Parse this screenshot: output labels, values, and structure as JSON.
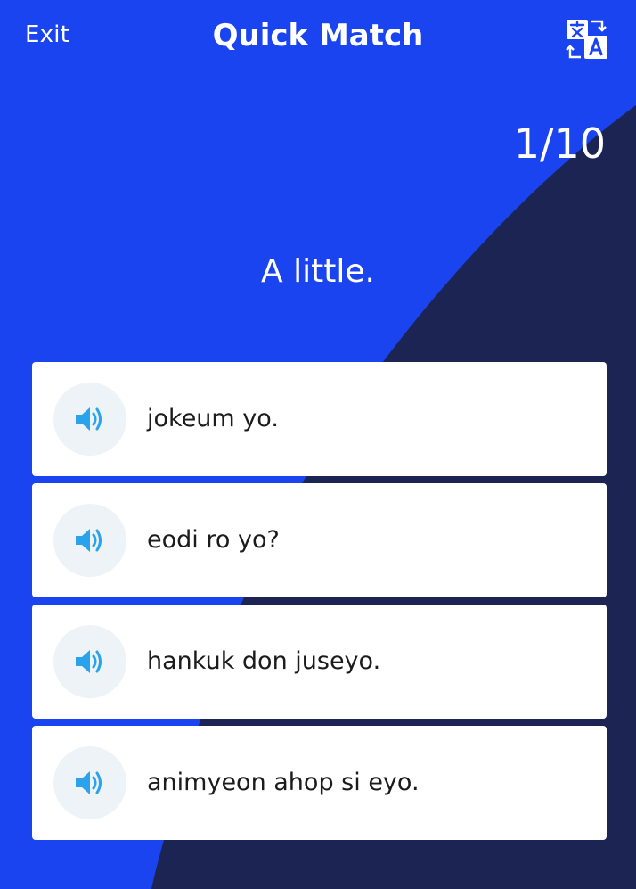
{
  "header": {
    "exit_label": "Exit",
    "title": "Quick Match",
    "translate_icon": "translate-icon"
  },
  "progress": "1/10",
  "prompt": "A little.",
  "options": [
    {
      "text": "jokeum yo.",
      "icon": "speaker-icon"
    },
    {
      "text": "eodi ro yo?",
      "icon": "speaker-icon"
    },
    {
      "text": "hankuk don juseyo.",
      "icon": "speaker-icon"
    },
    {
      "text": "animyeon ahop si eyo.",
      "icon": "speaker-icon"
    }
  ],
  "colors": {
    "background": "#1a44f0",
    "wave": "#1c2453",
    "card": "#ffffff",
    "speaker_bg": "#eef3f8",
    "speaker_icon": "#2aa2ec"
  }
}
